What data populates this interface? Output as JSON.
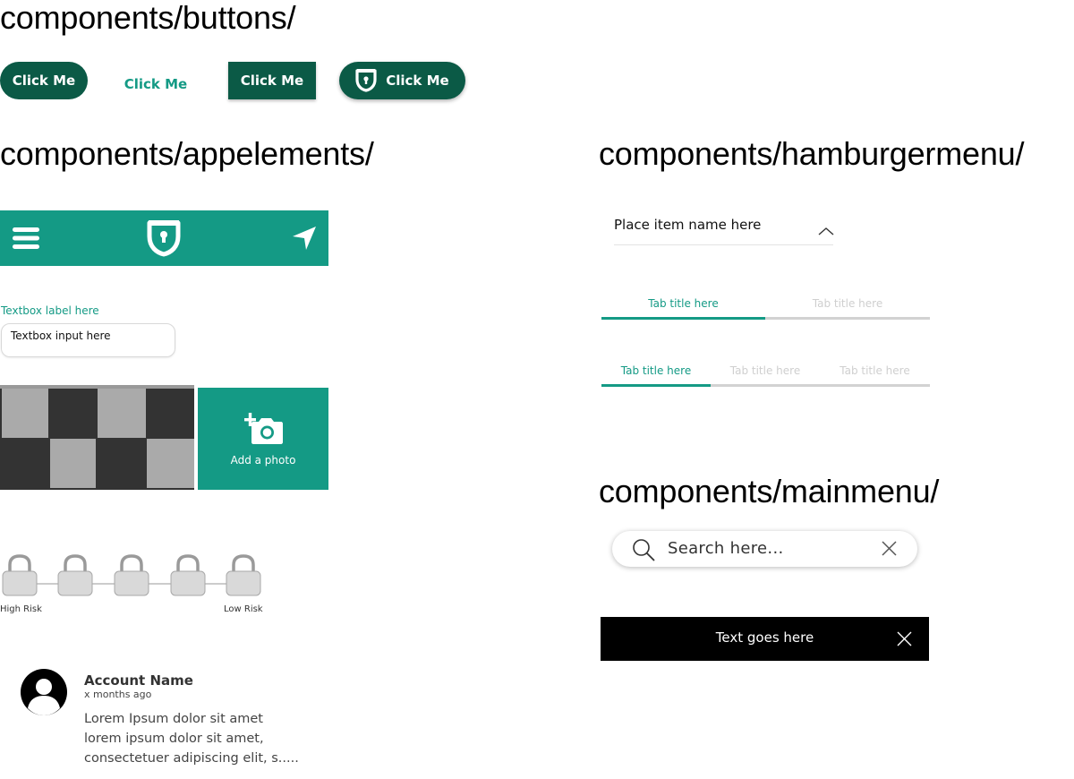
{
  "headings": {
    "buttons": "components/buttons/",
    "appelements": "components/appelements/",
    "hamburgermenu": "components/hamburgermenu/",
    "mainmenu": "components/mainmenu/"
  },
  "buttons": {
    "pill_label": "Click Me",
    "flat_label": "Click Me",
    "rect_label": "Click Me",
    "icon_label": "Click Me",
    "icon_name": "shield-lock-icon"
  },
  "appbar": {
    "left_icon": "menu-icon",
    "center_icon": "shield-lock-icon",
    "right_icon": "navigation-arrow-icon"
  },
  "textbox": {
    "label": "Textbox label here",
    "value": "Textbox input here"
  },
  "photo": {
    "add_label": "Add a photo",
    "add_icon": "add-camera-icon"
  },
  "risk": {
    "levels": 5,
    "left_label": "High Risk",
    "right_label": "Low Risk"
  },
  "account": {
    "name": "Account Name",
    "time": "x months ago",
    "body_lines": [
      "Lorem Ipsum dolor sit amet",
      "lorem ipsum dolor sit amet,",
      "consectetuer adipiscing elit, s....."
    ]
  },
  "hamburger": {
    "item_name": "Place item name here",
    "tabs_two": [
      "Tab title here",
      "Tab title here"
    ],
    "tabs_three": [
      "Tab title here",
      "Tab title here",
      "Tab title here"
    ]
  },
  "mainmenu": {
    "search_placeholder": "Search here...",
    "toast_text": "Text goes here"
  },
  "colors": {
    "brand_dark": "#0b5a46",
    "brand_teal": "#149a85",
    "toast_bg": "#000000"
  }
}
